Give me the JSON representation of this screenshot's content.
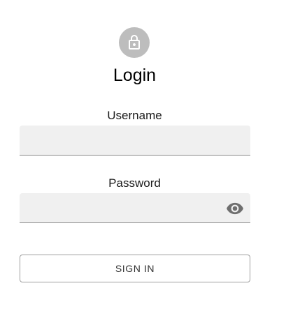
{
  "header": {
    "icon": "lock-icon",
    "title": "Login"
  },
  "form": {
    "username": {
      "label": "Username",
      "value": "",
      "placeholder": ""
    },
    "password": {
      "label": "Password",
      "value": "",
      "placeholder": "",
      "toggle_icon": "eye-icon"
    },
    "submit_label": "SIGN IN"
  },
  "colors": {
    "avatar_bg": "#bdbdbd",
    "field_bg": "#f0f0f0",
    "icon_gray": "#6e6e6e"
  }
}
